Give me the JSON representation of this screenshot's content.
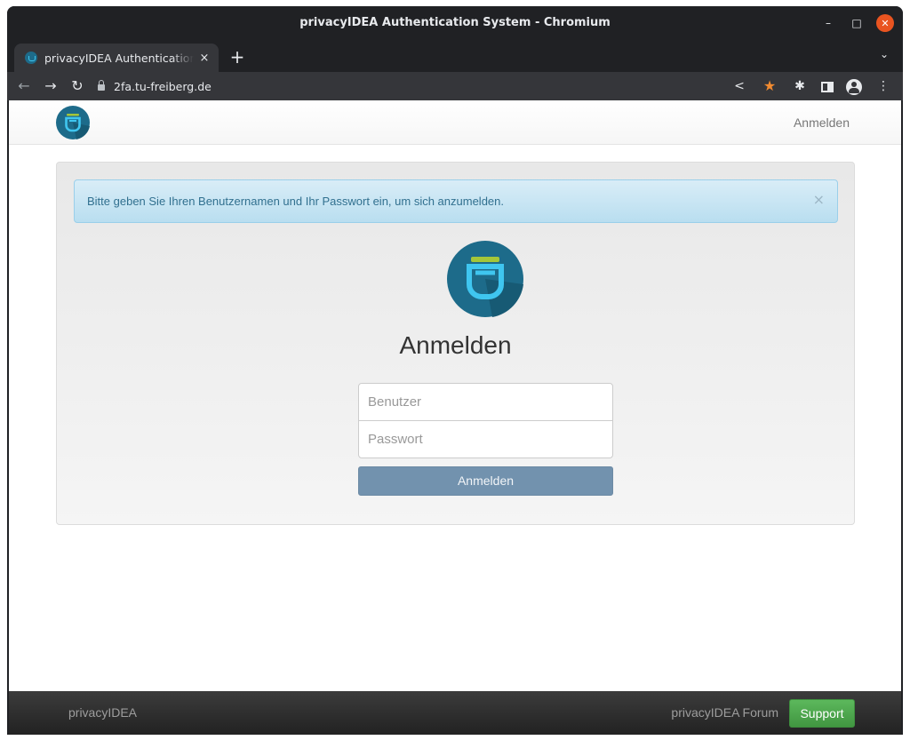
{
  "window": {
    "title": "privacyIDEA Authentication System - Chromium"
  },
  "tab": {
    "title": "privacyIDEA Authentication System",
    "close_glyph": "×",
    "new_tab_glyph": "+"
  },
  "address_bar": {
    "url": "2fa.tu-freiberg.de"
  },
  "navbar": {
    "login_link": "Anmelden"
  },
  "alert": {
    "message": "Bitte geben Sie Ihren Benutzernamen und Ihr Passwort ein, um sich anzumelden.",
    "close_glyph": "×"
  },
  "login": {
    "heading": "Anmelden",
    "username_placeholder": "Benutzer",
    "password_placeholder": "Passwort",
    "submit_label": "Anmelden"
  },
  "footer": {
    "brand": "privacyIDEA",
    "forum_link": "privacyIDEA Forum",
    "support_label": "Support"
  },
  "colors": {
    "logo_circle": "#1d6b8a",
    "logo_cup": "#3fc6f0",
    "logo_accent": "#a4c639",
    "submit_button": "#7292ae",
    "support_button": "#5cb85c",
    "alert_text": "#31708f"
  }
}
